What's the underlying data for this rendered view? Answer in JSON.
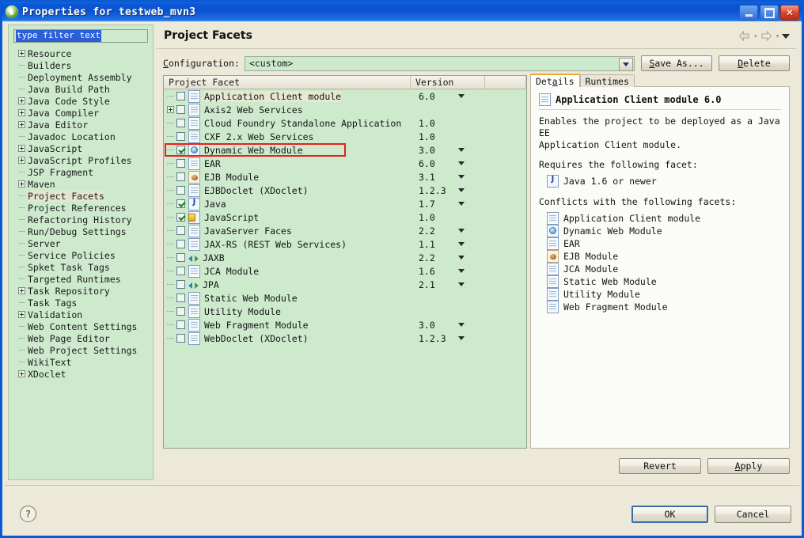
{
  "window": {
    "title": "Properties for testweb_mvn3",
    "icon": "eclipse-leaf-icon",
    "buttons": {
      "minimize": "minimize-icon",
      "maximize": "maximize-icon",
      "close": "close-icon"
    }
  },
  "sidebar": {
    "filter": {
      "value": "type filter text",
      "placeholder": "type filter text"
    },
    "items": [
      {
        "label": "Resource",
        "expandable": true,
        "selected": false
      },
      {
        "label": "Builders",
        "expandable": false,
        "selected": false
      },
      {
        "label": "Deployment Assembly",
        "expandable": false,
        "selected": false
      },
      {
        "label": "Java Build Path",
        "expandable": false,
        "selected": false
      },
      {
        "label": "Java Code Style",
        "expandable": true,
        "selected": false
      },
      {
        "label": "Java Compiler",
        "expandable": true,
        "selected": false
      },
      {
        "label": "Java Editor",
        "expandable": true,
        "selected": false
      },
      {
        "label": "Javadoc Location",
        "expandable": false,
        "selected": false
      },
      {
        "label": "JavaScript",
        "expandable": true,
        "selected": false
      },
      {
        "label": "JavaScript Profiles",
        "expandable": true,
        "selected": false
      },
      {
        "label": "JSP Fragment",
        "expandable": false,
        "selected": false
      },
      {
        "label": "Maven",
        "expandable": true,
        "selected": false
      },
      {
        "label": "Project Facets",
        "expandable": false,
        "selected": true
      },
      {
        "label": "Project References",
        "expandable": false,
        "selected": false
      },
      {
        "label": "Refactoring History",
        "expandable": false,
        "selected": false
      },
      {
        "label": "Run/Debug Settings",
        "expandable": false,
        "selected": false
      },
      {
        "label": "Server",
        "expandable": false,
        "selected": false
      },
      {
        "label": "Service Policies",
        "expandable": false,
        "selected": false
      },
      {
        "label": "Spket Task Tags",
        "expandable": false,
        "selected": false
      },
      {
        "label": "Targeted Runtimes",
        "expandable": false,
        "selected": false
      },
      {
        "label": "Task Repository",
        "expandable": true,
        "selected": false
      },
      {
        "label": "Task Tags",
        "expandable": false,
        "selected": false
      },
      {
        "label": "Validation",
        "expandable": true,
        "selected": false
      },
      {
        "label": "Web Content Settings",
        "expandable": false,
        "selected": false
      },
      {
        "label": "Web Page Editor",
        "expandable": false,
        "selected": false
      },
      {
        "label": "Web Project Settings",
        "expandable": false,
        "selected": false
      },
      {
        "label": "WikiText",
        "expandable": false,
        "selected": false
      },
      {
        "label": "XDoclet",
        "expandable": true,
        "selected": false
      }
    ]
  },
  "page": {
    "title": "Project Facets",
    "nav": {
      "back": "back-arrow-icon",
      "forward": "forward-arrow-icon",
      "menu": "chevron-down-icon"
    }
  },
  "configuration": {
    "label": "Configuration:",
    "label_underline": "C",
    "value": "<custom>",
    "save_as": "Save As...",
    "save_as_underline": "S",
    "delete": "Delete",
    "delete_underline": "D"
  },
  "facet_table": {
    "columns": [
      "Project Facet",
      "Version",
      ""
    ],
    "rows": [
      {
        "name": "Application Client module",
        "version": "6.0",
        "checked": false,
        "expandable": false,
        "icon": "document-icon",
        "has_version_dropdown": true,
        "highlighted": false,
        "name_selected": true
      },
      {
        "name": "Axis2 Web Services",
        "version": "",
        "checked": false,
        "expandable": true,
        "icon": "document-icon",
        "has_version_dropdown": false,
        "highlighted": false,
        "name_selected": false
      },
      {
        "name": "Cloud Foundry Standalone Application",
        "version": "1.0",
        "checked": false,
        "expandable": false,
        "icon": "document-icon",
        "has_version_dropdown": false,
        "highlighted": false,
        "name_selected": false
      },
      {
        "name": "CXF 2.x Web Services",
        "version": "1.0",
        "checked": false,
        "expandable": false,
        "icon": "document-icon",
        "has_version_dropdown": false,
        "highlighted": false,
        "name_selected": false
      },
      {
        "name": "Dynamic Web Module",
        "version": "3.0",
        "checked": true,
        "expandable": false,
        "icon": "globe-icon",
        "has_version_dropdown": true,
        "highlighted": true,
        "name_selected": false
      },
      {
        "name": "EAR",
        "version": "6.0",
        "checked": false,
        "expandable": false,
        "icon": "document-icon",
        "has_version_dropdown": true,
        "highlighted": false,
        "name_selected": false
      },
      {
        "name": "EJB Module",
        "version": "3.1",
        "checked": false,
        "expandable": false,
        "icon": "bean-icon",
        "has_version_dropdown": true,
        "highlighted": false,
        "name_selected": false
      },
      {
        "name": "EJBDoclet (XDoclet)",
        "version": "1.2.3",
        "checked": false,
        "expandable": false,
        "icon": "document-icon",
        "has_version_dropdown": true,
        "highlighted": false,
        "name_selected": false
      },
      {
        "name": "Java",
        "version": "1.7",
        "checked": true,
        "expandable": false,
        "icon": "java-icon",
        "has_version_dropdown": true,
        "highlighted": false,
        "name_selected": false
      },
      {
        "name": "JavaScript",
        "version": "1.0",
        "checked": true,
        "expandable": false,
        "icon": "javascript-lock-icon",
        "has_version_dropdown": false,
        "highlighted": false,
        "name_selected": false
      },
      {
        "name": "JavaServer Faces",
        "version": "2.2",
        "checked": false,
        "expandable": false,
        "icon": "document-icon",
        "has_version_dropdown": true,
        "highlighted": false,
        "name_selected": false
      },
      {
        "name": "JAX-RS (REST Web Services)",
        "version": "1.1",
        "checked": false,
        "expandable": false,
        "icon": "document-icon",
        "has_version_dropdown": true,
        "highlighted": false,
        "name_selected": false
      },
      {
        "name": "JAXB",
        "version": "2.2",
        "checked": false,
        "expandable": false,
        "icon": "arrows-icon",
        "has_version_dropdown": true,
        "highlighted": false,
        "name_selected": false
      },
      {
        "name": "JCA Module",
        "version": "1.6",
        "checked": false,
        "expandable": false,
        "icon": "document-icon",
        "has_version_dropdown": true,
        "highlighted": false,
        "name_selected": false
      },
      {
        "name": "JPA",
        "version": "2.1",
        "checked": false,
        "expandable": false,
        "icon": "arrows-icon",
        "has_version_dropdown": true,
        "highlighted": false,
        "name_selected": false
      },
      {
        "name": "Static Web Module",
        "version": "",
        "checked": false,
        "expandable": false,
        "icon": "document-icon",
        "has_version_dropdown": false,
        "highlighted": false,
        "name_selected": false
      },
      {
        "name": "Utility Module",
        "version": "",
        "checked": false,
        "expandable": false,
        "icon": "document-icon",
        "has_version_dropdown": false,
        "highlighted": false,
        "name_selected": false
      },
      {
        "name": "Web Fragment Module",
        "version": "3.0",
        "checked": false,
        "expandable": false,
        "icon": "document-icon",
        "has_version_dropdown": true,
        "highlighted": false,
        "name_selected": false
      },
      {
        "name": "WebDoclet (XDoclet)",
        "version": "1.2.3",
        "checked": false,
        "expandable": false,
        "icon": "document-icon",
        "has_version_dropdown": true,
        "highlighted": false,
        "name_selected": false
      }
    ]
  },
  "details_panel": {
    "tabs": [
      {
        "label": "Details",
        "underline": "a",
        "active": true
      },
      {
        "label": "Runtimes",
        "underline": "",
        "active": false
      }
    ],
    "heading": "Application Client module 6.0",
    "heading_icon": "document-icon",
    "description": "Enables the project to be deployed as a Java EE\nApplication Client module.",
    "requires_label": "Requires the following facet:",
    "requires": [
      {
        "label": "Java 1.6 or newer",
        "icon": "java-icon"
      }
    ],
    "conflicts_label": "Conflicts with the following facets:",
    "conflicts": [
      {
        "label": "Application Client module",
        "icon": "document-icon"
      },
      {
        "label": "Dynamic Web Module",
        "icon": "globe-icon"
      },
      {
        "label": "EAR",
        "icon": "document-icon"
      },
      {
        "label": "EJB Module",
        "icon": "bean-icon"
      },
      {
        "label": "JCA Module",
        "icon": "document-icon"
      },
      {
        "label": "Static Web Module",
        "icon": "document-icon"
      },
      {
        "label": "Utility Module",
        "icon": "document-icon"
      },
      {
        "label": "Web Fragment Module",
        "icon": "document-icon"
      }
    ]
  },
  "action_buttons": {
    "revert": "Revert",
    "apply": "Apply",
    "apply_underline": "A",
    "ok": "OK",
    "cancel": "Cancel",
    "help": "?"
  },
  "colors": {
    "titlebar": "#0a57d6",
    "dialog_bg": "#ece9d8",
    "field_bg": "#cdeacd",
    "highlight_red": "#ee1c1c",
    "selection_blue": "#2b5fd9",
    "tab_accent": "#f0a830"
  }
}
